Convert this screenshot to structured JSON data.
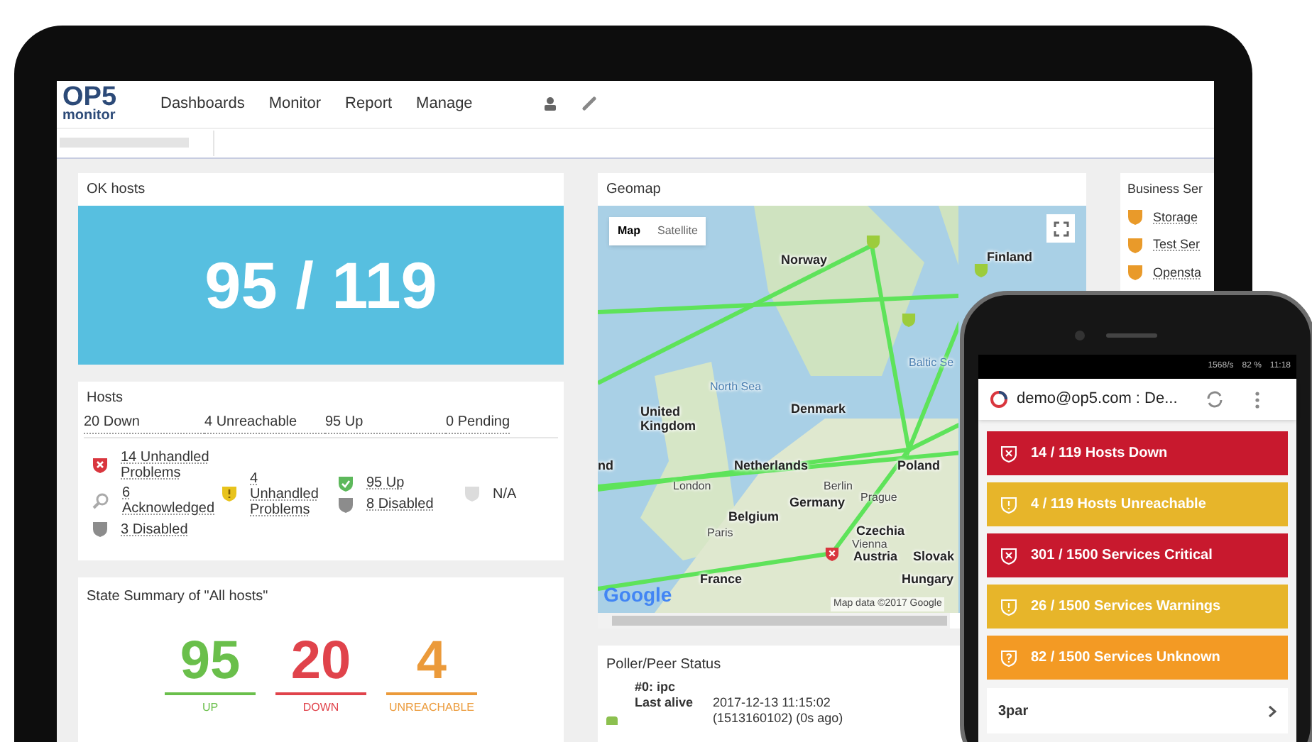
{
  "app": {
    "logo": "OP5",
    "logo_sub": "monitor",
    "nav": [
      "Dashboards",
      "Monitor",
      "Report",
      "Manage"
    ]
  },
  "ok_hosts": {
    "title": "OK hosts",
    "value": "95 / 119"
  },
  "hosts": {
    "title": "Hosts",
    "summary": [
      "20 Down",
      "4 Unreachable",
      "95 Up",
      "0 Pending"
    ],
    "columns": [
      [
        {
          "kind": "down",
          "label": "14 Unhandled Problems"
        },
        {
          "kind": "acknowledged",
          "label": "6 Acknowledged"
        },
        {
          "kind": "disabled",
          "label": "3 Disabled"
        }
      ],
      [
        {
          "kind": "unreachable",
          "label": "4 Unhandled Problems"
        }
      ],
      [
        {
          "kind": "up",
          "label": "95 Up"
        },
        {
          "kind": "disabled",
          "label": "8 Disabled"
        }
      ],
      [
        {
          "kind": "pending",
          "label": "N/A"
        }
      ]
    ]
  },
  "state_summary": {
    "title": "State Summary of \"All hosts\"",
    "items": [
      {
        "value": "95",
        "label": "UP",
        "color": "#6abf4b"
      },
      {
        "value": "20",
        "label": "DOWN",
        "color": "#e0434b"
      },
      {
        "value": "4",
        "label": "UNREACHABLE",
        "color": "#eb9a3a"
      }
    ]
  },
  "geomap": {
    "title": "Geomap",
    "map_types": [
      {
        "label": "Map",
        "selected": true
      },
      {
        "label": "Satellite",
        "selected": false
      }
    ],
    "labels": [
      {
        "text": "Norway",
        "kind": "country"
      },
      {
        "text": "Finland",
        "kind": "country"
      },
      {
        "text": "Baltic Se",
        "kind": "sea"
      },
      {
        "text": "North Sea",
        "kind": "sea"
      },
      {
        "text": "United Kingdom",
        "kind": "country"
      },
      {
        "text": "Denmark",
        "kind": "country"
      },
      {
        "text": "nd",
        "kind": "country"
      },
      {
        "text": "Netherlands",
        "kind": "country"
      },
      {
        "text": "Poland",
        "kind": "country"
      },
      {
        "text": "London",
        "kind": "city"
      },
      {
        "text": "Berlin",
        "kind": "city"
      },
      {
        "text": "Germany",
        "kind": "country"
      },
      {
        "text": "Prague",
        "kind": "city"
      },
      {
        "text": "Belgium",
        "kind": "country"
      },
      {
        "text": "Paris",
        "kind": "city"
      },
      {
        "text": "Czechia",
        "kind": "country"
      },
      {
        "text": "Vienna",
        "kind": "city"
      },
      {
        "text": "Austria",
        "kind": "country"
      },
      {
        "text": "Slovak",
        "kind": "country"
      },
      {
        "text": "France",
        "kind": "country"
      },
      {
        "text": "Hungary",
        "kind": "country"
      }
    ],
    "attribution": "Google",
    "map_data": "Map data ©2017 Google"
  },
  "poller": {
    "title": "Poller/Peer Status",
    "name": "#0: ipc",
    "field": "Last alive",
    "value": "2017-12-13 11:15:02",
    "value_2": "(1513160102) (0s ago)"
  },
  "business_services": {
    "title": "Business Ser",
    "items": [
      "Storage",
      "Test Ser",
      "Opensta"
    ]
  },
  "phone": {
    "status": [
      "1568/s",
      "82 %",
      "11:18"
    ],
    "title": "demo@op5.com : De...",
    "alerts": [
      {
        "kind": "critical",
        "text": "14 / 119 Hosts Down"
      },
      {
        "kind": "warning",
        "text": "4 / 119 Hosts Unreachable"
      },
      {
        "kind": "critical",
        "text": "301 / 1500 Services Critical"
      },
      {
        "kind": "warning",
        "text": "26 / 1500 Services Warnings"
      },
      {
        "kind": "unknown",
        "text": "82 / 1500 Services Unknown"
      }
    ],
    "list": [
      "3par"
    ]
  }
}
